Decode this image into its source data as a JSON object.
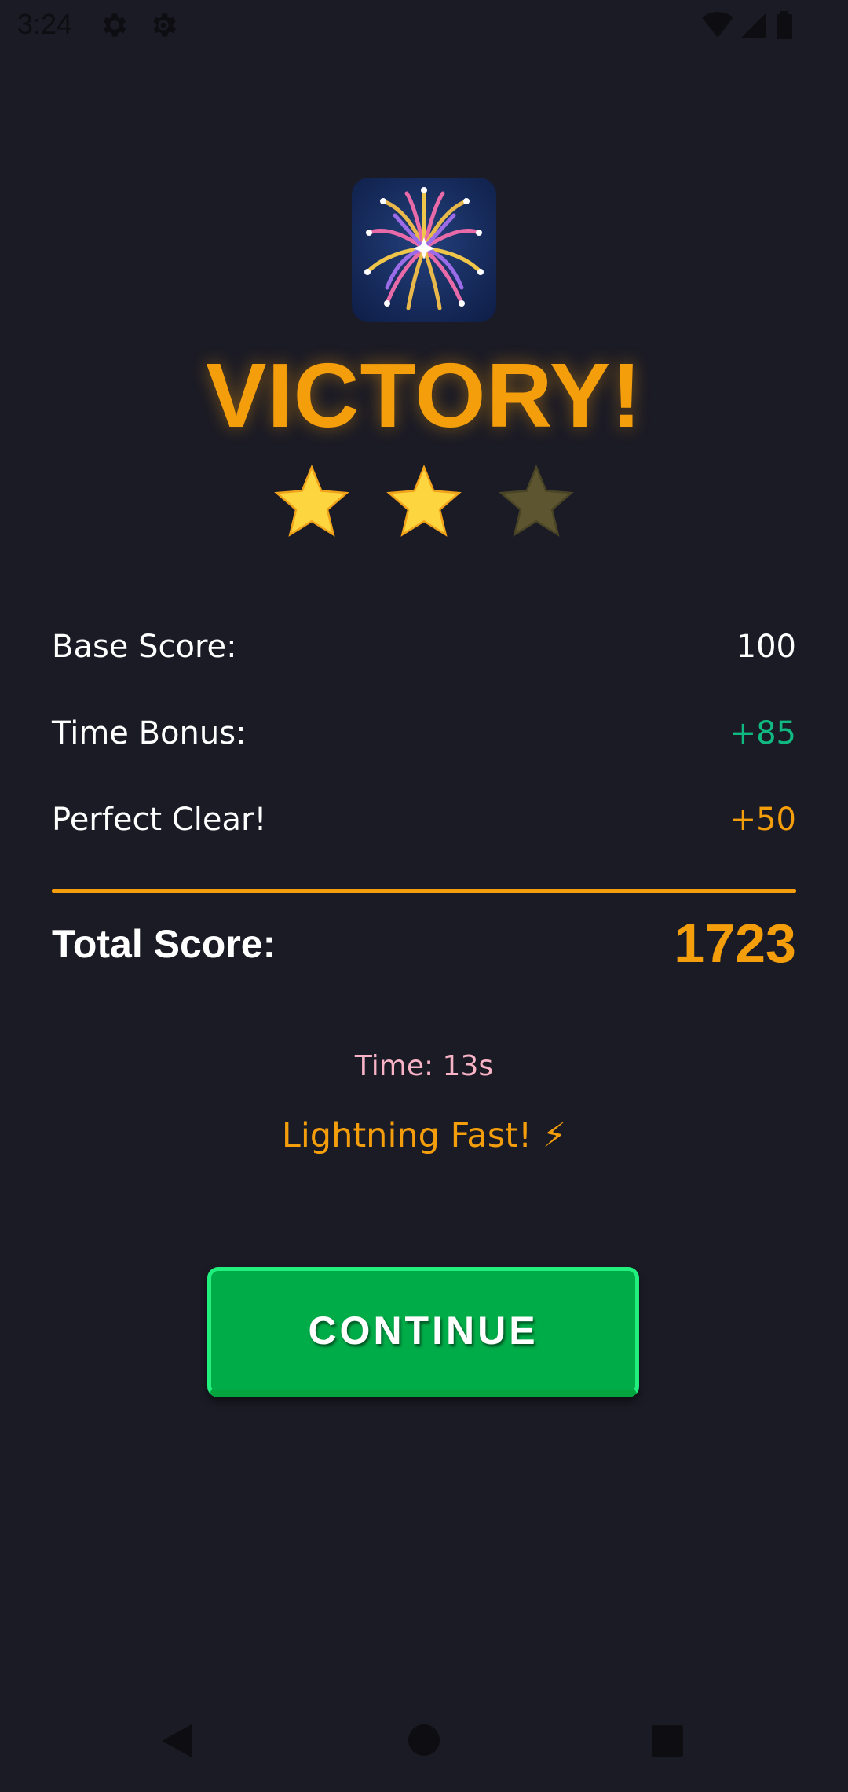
{
  "status_bar": {
    "time": "3:24",
    "icons": [
      "gear-icon",
      "gear-outline-icon",
      "wifi-icon",
      "signal-icon",
      "battery-icon"
    ]
  },
  "result": {
    "icon": "fireworks-icon",
    "title": "VICTORY!",
    "stars_earned": 2,
    "stars_total": 3
  },
  "score_rows": [
    {
      "label": "Base Score:",
      "value": "100",
      "color": "#ffffff"
    },
    {
      "label": "Time Bonus:",
      "value": "+85",
      "color": "#10b981"
    },
    {
      "label": "Perfect Clear!",
      "value": "+50",
      "color": "#f59e0b"
    }
  ],
  "total": {
    "label": "Total Score:",
    "value": "1723"
  },
  "time_text": "Time: 13s",
  "speed_text": "Lightning Fast! ⚡",
  "continue_label": "CONTINUE",
  "nav_bar": {
    "icons": [
      "back-icon",
      "home-icon",
      "recents-icon"
    ]
  },
  "colors": {
    "background": "#1b1b25",
    "accent": "#f59e0b",
    "bonus_green": "#10b981",
    "button_green": "#00ac48",
    "time_pink": "#f9b3c6"
  }
}
